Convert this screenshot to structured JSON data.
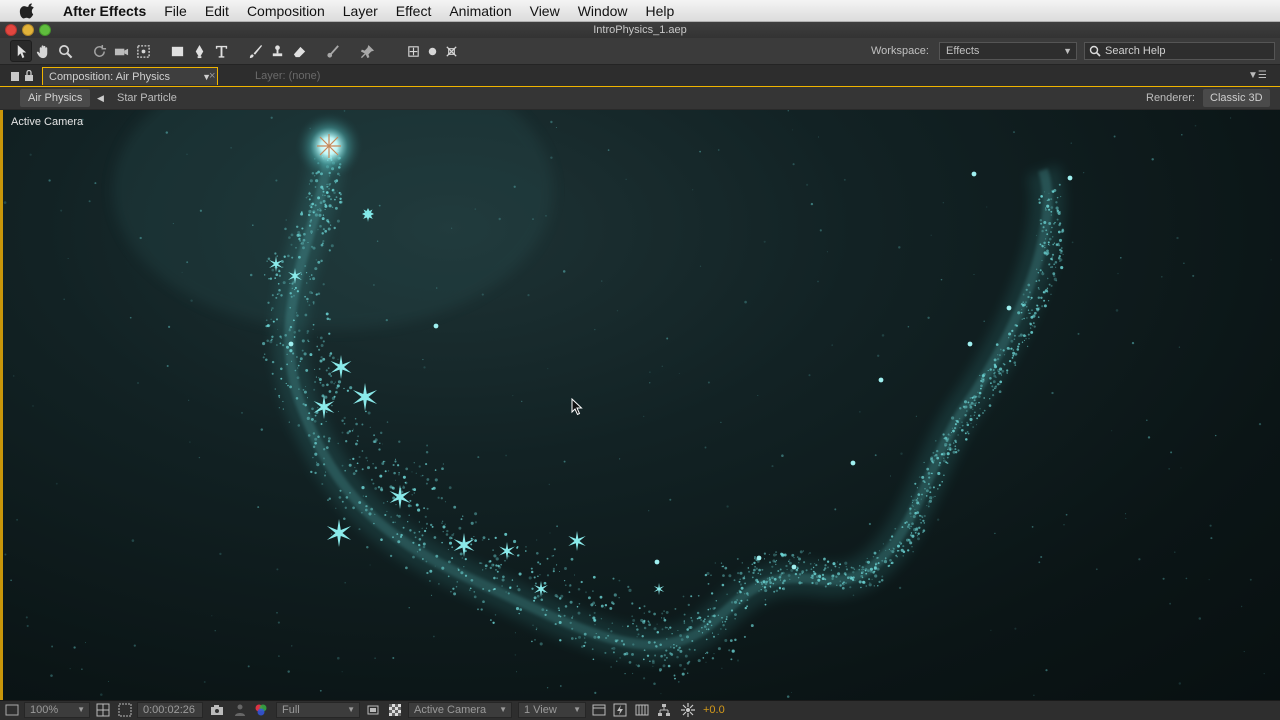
{
  "menubar": {
    "app_name": "After Effects",
    "items": [
      "File",
      "Edit",
      "Composition",
      "Layer",
      "Effect",
      "Animation",
      "View",
      "Window",
      "Help"
    ]
  },
  "window": {
    "title": "IntroPhysics_1.aep"
  },
  "toolbar": {
    "tools": [
      "selection-tool-icon",
      "hand-tool-icon",
      "zoom-tool-icon",
      "rotate-tool-icon",
      "camera-orbit-tool-icon",
      "pan-behind-tool-icon",
      "rectangle-tool-icon",
      "pen-tool-icon",
      "type-tool-icon",
      "brush-tool-icon",
      "clone-stamp-tool-icon",
      "eraser-tool-icon",
      "roto-brush-tool-icon",
      "puppet-pin-tool-icon",
      "axis-local-icon",
      "axis-world-icon",
      "axis-view-icon"
    ],
    "workspace_label": "Workspace:",
    "workspace_value": "Effects",
    "search_placeholder": "Search Help"
  },
  "panel": {
    "comp_tab": "Composition: Air Physics",
    "layer_tab": "Layer: (none)",
    "breadcrumbs": [
      "Air Physics",
      "Star Particle"
    ],
    "renderer_label": "Renderer:",
    "renderer_value": "Classic 3D"
  },
  "viewer": {
    "camera_label": "Active Camera",
    "accent_color": "#4fd0d0"
  },
  "statusbar": {
    "zoom": "100%",
    "timecode": "0:00:02:26",
    "resolution": "Full",
    "view_camera": "Active Camera",
    "view_layout": "1 View",
    "exposure": "+0.0"
  }
}
